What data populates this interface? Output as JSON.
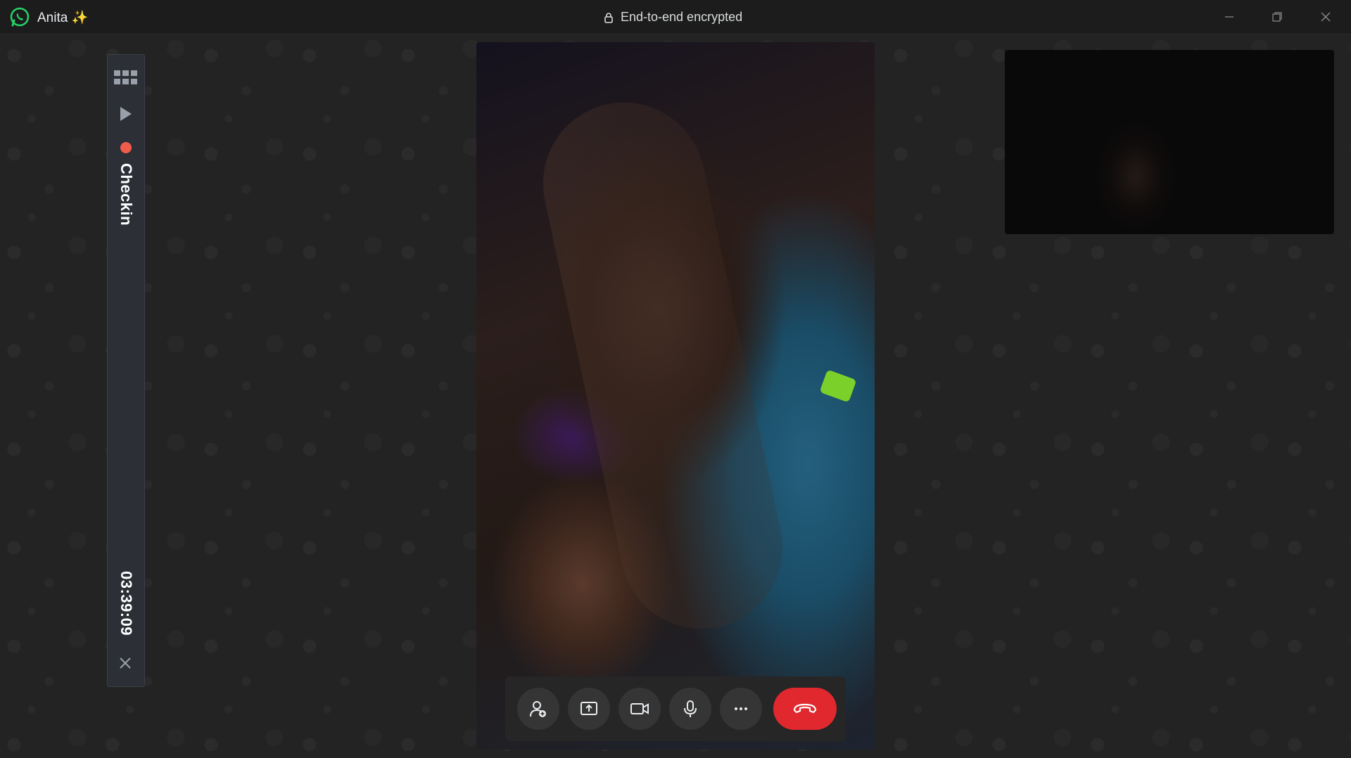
{
  "app": {
    "contact_name": "Anita",
    "contact_emoji": "✨",
    "encryption_label": "End-to-end encrypted"
  },
  "window_controls": [
    "minimize-icon",
    "restore-icon",
    "close-icon"
  ],
  "recorder": {
    "label": "Checkin",
    "elapsed": "03:39:09",
    "recording_color": "#f15c4a",
    "icons": [
      "grid-icon",
      "play-icon",
      "record-dot-icon",
      "close-icon"
    ]
  },
  "call_controls": {
    "buttons": [
      "add-participant-icon",
      "share-screen-icon",
      "video-camera-icon",
      "microphone-icon",
      "more-options-icon",
      "end-call-icon"
    ],
    "end_call_color": "#e0282e"
  },
  "colors": {
    "whatsapp_green": "#25d366"
  }
}
